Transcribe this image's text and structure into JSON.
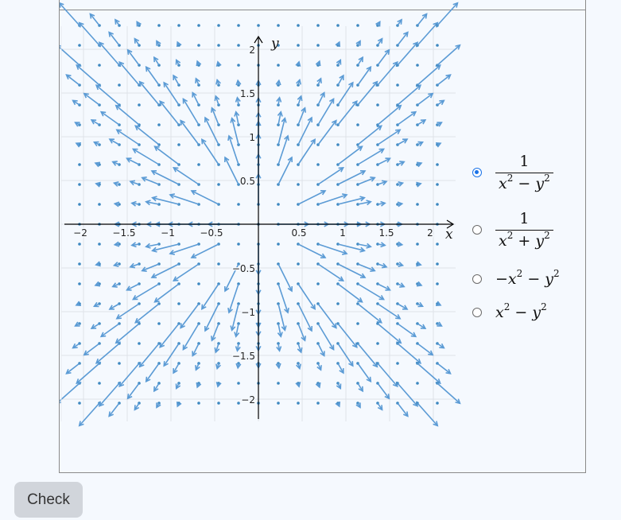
{
  "plot": {
    "x_axis_label": "x",
    "y_axis_label": "y",
    "x_ticks": [
      "−2",
      "−1.5",
      "−1",
      "−0.5",
      "0.5",
      "1",
      "1.5",
      "2"
    ],
    "y_ticks": [
      "2",
      "1.5",
      "1",
      "0.5",
      "−0.5",
      "−1",
      "−1.5",
      "−2"
    ],
    "arrow_color": "#5b9bd5",
    "axis_color": "#000000"
  },
  "options": [
    {
      "selected": true,
      "numerator": "1",
      "den_left": "x",
      "den_op": " − ",
      "den_right": "y"
    },
    {
      "selected": false,
      "numerator": "1",
      "den_left": "x",
      "den_op": " + ",
      "den_right": "y"
    },
    {
      "selected": false,
      "prefix": "−",
      "left": "x",
      "op": " − ",
      "right": "y"
    },
    {
      "selected": false,
      "prefix": "",
      "left": "x",
      "op": " − ",
      "right": "y"
    }
  ],
  "check_button": "Check"
}
